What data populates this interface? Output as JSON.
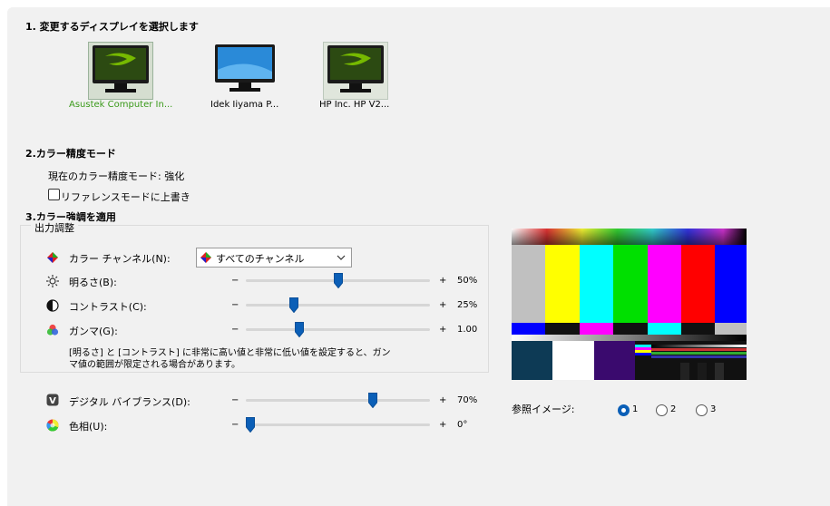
{
  "section1": {
    "title": "1. 変更するディスプレイを選択します"
  },
  "displays": [
    {
      "label": "Asustek Computer In...",
      "icon": "nvidia-monitor-icon",
      "selected": true
    },
    {
      "label": "Idek Iiyama P...",
      "icon": "windows-monitor-icon",
      "selected": false
    },
    {
      "label": "HP Inc. HP V2...",
      "icon": "nvidia-monitor-icon",
      "selected": false
    }
  ],
  "section2": {
    "title": "2.カラー精度モード",
    "current_mode": "現在のカラー精度モード: 強化",
    "override_checkbox": {
      "label": "リファレンスモードに上書き",
      "checked": false
    }
  },
  "section3": {
    "title": "3.カラー強調を適用",
    "group_title": "出力調整",
    "channel": {
      "label": "カラー チャンネル(N):",
      "value": "すべてのチャンネル"
    },
    "brightness": {
      "label": "明るさ(B):",
      "value": "50%",
      "level": 0.5
    },
    "contrast": {
      "label": "コントラスト(C):",
      "value": "25%",
      "level": 0.25
    },
    "gamma": {
      "label": "ガンマ(G):",
      "value": "1.00",
      "level": 0.28
    },
    "note": "[明るさ] と [コントラスト] に非常に高い値と非常に低い値を設定すると、ガンマ値の範囲が限定される場合があります。",
    "vibrance": {
      "label": "デジタル バイブランス(D):",
      "value": "70%",
      "level": 0.7
    },
    "hue": {
      "label": "色相(U):",
      "value": "0°",
      "level": 0.0
    }
  },
  "slider_minus": "−",
  "slider_plus": "+",
  "reference": {
    "label": "参照イメージ:",
    "options": [
      "1",
      "2",
      "3"
    ],
    "selected": "1"
  },
  "colors": {
    "nvidia_green": "#76b900",
    "accent_blue": "#0b5fb7",
    "selected_text": "#3a9a1a"
  }
}
